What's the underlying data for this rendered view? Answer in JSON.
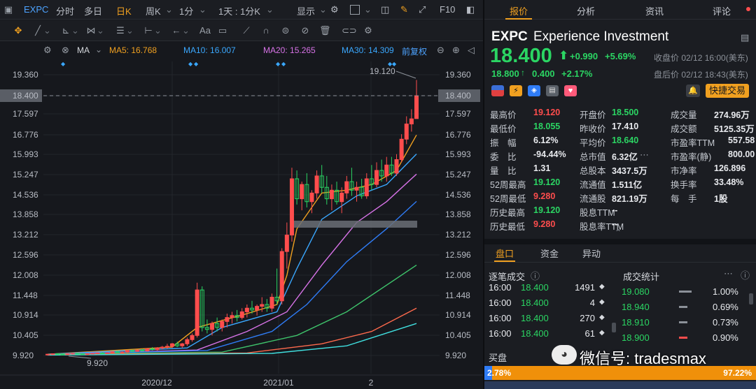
{
  "toolbar": {
    "symbol": "EXPC",
    "fenshi": "分时",
    "duori": "多日",
    "rik": "日K",
    "zhouk": "周K",
    "yifen": "1分",
    "range": "1天 : 1分K",
    "display": "显示",
    "f10": "F10"
  },
  "toolbar2": {
    "aa": "Aa"
  },
  "indicator_bar": {
    "ma": "MA",
    "ma5": "MA5: 16.768",
    "ma10": "MA10: 16.007",
    "ma20": "MA20: 15.265",
    "ma30": "MA30: 14.309",
    "fuquan": "前复权"
  },
  "colors": {
    "up": "#ff4d4d",
    "down": "#2bd563",
    "ma5": "#f0a020",
    "ma10": "#3aa8ff",
    "ma20": "#d873e8",
    "ma30": "#2f7cf6",
    "ma60": "#3ec36b",
    "ma120": "#ff6a4d",
    "ma250": "#40e0e0",
    "accent": "#f0a020"
  },
  "chart_data": {
    "type": "candlestick",
    "y_ticks": [
      "19.360",
      "18.400",
      "17.597",
      "16.776",
      "15.993",
      "15.247",
      "14.536",
      "13.858",
      "13.212",
      "12.596",
      "12.008",
      "11.448",
      "10.914",
      "10.405",
      "9.920"
    ],
    "x_ticks": [
      "2020/12",
      "2021/01",
      "2"
    ],
    "annotations": {
      "high": "19.120",
      "low": "9.920",
      "last": "18.400"
    },
    "candles": [
      [
        9.95,
        9.96,
        9.92,
        9.95
      ],
      [
        9.95,
        9.97,
        9.93,
        9.96
      ],
      [
        9.96,
        9.97,
        9.94,
        9.95
      ],
      [
        9.95,
        9.96,
        9.93,
        9.94
      ],
      [
        9.94,
        9.97,
        9.93,
        9.96
      ],
      [
        9.96,
        9.98,
        9.94,
        9.97
      ],
      [
        9.97,
        9.98,
        9.95,
        9.96
      ],
      [
        9.96,
        9.97,
        9.94,
        9.95
      ],
      [
        9.95,
        9.97,
        9.93,
        9.96
      ],
      [
        9.96,
        9.98,
        9.95,
        9.97
      ],
      [
        9.97,
        9.99,
        9.95,
        9.98
      ],
      [
        9.98,
        10.0,
        9.96,
        9.97
      ],
      [
        9.97,
        9.99,
        9.96,
        9.98
      ],
      [
        9.98,
        10.02,
        9.97,
        10.01
      ],
      [
        10.01,
        10.03,
        9.98,
        9.99
      ],
      [
        9.99,
        10.02,
        9.97,
        10.0
      ],
      [
        10.0,
        10.05,
        9.98,
        10.04
      ],
      [
        10.04,
        10.06,
        10.0,
        10.02
      ],
      [
        10.02,
        10.06,
        10.0,
        10.05
      ],
      [
        10.05,
        10.08,
        10.02,
        10.03
      ],
      [
        10.03,
        10.1,
        10.01,
        10.08
      ],
      [
        10.08,
        10.12,
        10.04,
        10.06
      ],
      [
        10.06,
        10.12,
        10.04,
        10.1
      ],
      [
        10.1,
        10.15,
        10.06,
        10.12
      ],
      [
        10.12,
        10.2,
        10.08,
        10.14
      ],
      [
        10.14,
        10.22,
        10.1,
        10.2
      ],
      [
        10.2,
        10.25,
        10.12,
        10.15
      ],
      [
        10.15,
        10.22,
        10.1,
        10.2
      ],
      [
        10.2,
        10.35,
        10.15,
        10.3
      ],
      [
        10.3,
        10.45,
        10.25,
        10.4
      ],
      [
        10.4,
        11.8,
        10.35,
        11.6
      ],
      [
        11.6,
        11.7,
        10.5,
        10.6
      ],
      [
        10.6,
        10.8,
        10.45,
        10.55
      ],
      [
        10.55,
        10.75,
        10.4,
        10.7
      ],
      [
        10.7,
        10.85,
        10.5,
        10.6
      ],
      [
        10.6,
        10.8,
        10.5,
        10.75
      ],
      [
        10.75,
        10.95,
        10.6,
        10.85
      ],
      [
        10.85,
        11.0,
        10.7,
        10.9
      ],
      [
        10.9,
        11.05,
        10.75,
        10.85
      ],
      [
        10.85,
        11.1,
        10.8,
        11.0
      ],
      [
        11.0,
        11.2,
        10.85,
        11.1
      ],
      [
        11.1,
        11.3,
        10.95,
        11.05
      ],
      [
        11.05,
        11.2,
        10.9,
        11.15
      ],
      [
        11.15,
        11.4,
        11.0,
        11.2
      ],
      [
        11.2,
        11.35,
        11.0,
        11.1
      ],
      [
        11.1,
        11.5,
        11.0,
        11.4
      ],
      [
        11.4,
        12.2,
        11.2,
        11.3
      ],
      [
        11.3,
        12.8,
        11.2,
        12.7
      ],
      [
        12.7,
        13.6,
        12.2,
        13.2
      ],
      [
        13.2,
        15.5,
        13.0,
        15.1
      ],
      [
        15.1,
        15.4,
        14.2,
        14.4
      ],
      [
        14.4,
        15.0,
        14.0,
        14.9
      ],
      [
        14.9,
        15.3,
        14.1,
        14.3
      ],
      [
        14.3,
        14.7,
        13.9,
        14.6
      ],
      [
        14.6,
        15.4,
        14.4,
        15.2
      ],
      [
        15.2,
        15.6,
        14.6,
        14.8
      ],
      [
        14.8,
        15.2,
        14.2,
        14.4
      ],
      [
        14.4,
        14.9,
        14.0,
        14.7
      ],
      [
        14.7,
        15.0,
        14.2,
        14.3
      ],
      [
        14.3,
        14.8,
        13.9,
        14.6
      ],
      [
        14.6,
        15.2,
        14.4,
        15.0
      ],
      [
        15.0,
        15.5,
        14.5,
        14.7
      ],
      [
        14.7,
        15.0,
        14.3,
        14.8
      ],
      [
        14.8,
        15.1,
        14.4,
        14.5
      ],
      [
        14.5,
        15.3,
        14.4,
        15.1
      ],
      [
        15.1,
        15.6,
        14.7,
        14.9
      ],
      [
        14.9,
        15.7,
        14.8,
        15.4
      ],
      [
        15.4,
        15.8,
        15.0,
        15.2
      ],
      [
        15.2,
        15.9,
        15.0,
        15.6
      ],
      [
        15.6,
        15.9,
        15.2,
        15.3
      ],
      [
        15.3,
        16.0,
        15.2,
        15.8
      ],
      [
        15.8,
        16.8,
        15.7,
        16.6
      ],
      [
        16.6,
        17.5,
        16.4,
        17.2
      ],
      [
        17.2,
        17.8,
        16.9,
        17.4
      ],
      [
        17.41,
        19.12,
        18.055,
        18.4
      ]
    ],
    "ma": [
      {
        "name": "MA5",
        "color": "#f0a020",
        "values": [
          [
            0,
            9.95
          ],
          [
            25,
            10.12
          ],
          [
            30,
            10.6
          ],
          [
            40,
            10.95
          ],
          [
            46,
            11.2
          ],
          [
            48,
            12.0
          ],
          [
            50,
            13.4
          ],
          [
            55,
            14.6
          ],
          [
            60,
            14.7
          ],
          [
            65,
            14.9
          ],
          [
            70,
            15.4
          ],
          [
            74,
            16.768
          ]
        ]
      },
      {
        "name": "MA10",
        "color": "#3aa8ff",
        "values": [
          [
            0,
            9.95
          ],
          [
            28,
            10.1
          ],
          [
            35,
            10.6
          ],
          [
            46,
            11.0
          ],
          [
            50,
            12.2
          ],
          [
            55,
            13.7
          ],
          [
            62,
            14.5
          ],
          [
            68,
            14.9
          ],
          [
            74,
            16.007
          ]
        ]
      },
      {
        "name": "MA20",
        "color": "#d873e8",
        "values": [
          [
            0,
            9.95
          ],
          [
            30,
            10.05
          ],
          [
            40,
            10.5
          ],
          [
            48,
            11.0
          ],
          [
            55,
            12.3
          ],
          [
            62,
            13.6
          ],
          [
            68,
            14.3
          ],
          [
            74,
            15.265
          ]
        ]
      },
      {
        "name": "MA30",
        "color": "#2f7cf6",
        "values": [
          [
            0,
            9.95
          ],
          [
            32,
            10.04
          ],
          [
            45,
            10.5
          ],
          [
            52,
            11.2
          ],
          [
            60,
            12.4
          ],
          [
            68,
            13.4
          ],
          [
            74,
            14.309
          ]
        ]
      },
      {
        "name": "MA60",
        "color": "#3ec36b",
        "values": [
          [
            0,
            9.95
          ],
          [
            35,
            10.0
          ],
          [
            50,
            10.4
          ],
          [
            60,
            11.0
          ],
          [
            74,
            12.3
          ]
        ]
      },
      {
        "name": "MA120",
        "color": "#ff6a4d",
        "values": [
          [
            0,
            9.94
          ],
          [
            40,
            9.98
          ],
          [
            55,
            10.2
          ],
          [
            65,
            10.5
          ],
          [
            74,
            11.1
          ]
        ]
      },
      {
        "name": "MA250",
        "color": "#40e0e0",
        "values": [
          [
            0,
            9.93
          ],
          [
            45,
            9.97
          ],
          [
            60,
            10.15
          ],
          [
            74,
            10.7
          ]
        ]
      }
    ]
  },
  "right": {
    "tabs": [
      "报价",
      "分析",
      "资讯",
      "评论"
    ],
    "symbol": "EXPC",
    "name": "Experience Investment",
    "price": "18.400",
    "change": "+0.990",
    "change_pct": "+5.69%",
    "close_time": "收盘价 02/12 16:00(美东)",
    "after_price": "18.800",
    "after_change": "0.400",
    "after_pct": "+2.17%",
    "after_time": "盘后价 02/12 18:43(美东)",
    "quick_trade": "快捷交易",
    "stats": [
      [
        "最高价",
        "19.120",
        "red",
        "开盘价",
        "18.500",
        "green",
        "成交量",
        "274.96万",
        "white"
      ],
      [
        "最低价",
        "18.055",
        "green",
        "昨收价",
        "17.410",
        "white",
        "成交额",
        "5125.35万",
        "white"
      ],
      [
        "振　幅",
        "6.12%",
        "white",
        "平均价",
        "18.640",
        "green",
        "市盈率TTM",
        "557.58",
        "white"
      ],
      [
        "委　比",
        "-94.44%",
        "white",
        "总市值",
        "6.32亿",
        "white",
        "市盈率(静)",
        "800.00",
        "white"
      ],
      [
        "量　比",
        "1.31",
        "white",
        "总股本",
        "3437.5万",
        "white",
        "市净率",
        "126.896",
        "white"
      ],
      [
        "52周最高",
        "19.120",
        "green",
        "流通值",
        "1.511亿",
        "white",
        "换手率",
        "33.48%",
        "white"
      ],
      [
        "52周最低",
        "9.280",
        "red",
        "流通股",
        "821.19万",
        "white",
        "每　手",
        "1股",
        "white"
      ],
      [
        "历史最高",
        "19.120",
        "green",
        "股息TTM",
        "--",
        "white",
        "",
        "",
        ""
      ],
      [
        "历史最低",
        "9.280",
        "red",
        "股息率TTM",
        "--",
        "white",
        "",
        "",
        ""
      ]
    ],
    "subtabs": [
      "盘口",
      "资金",
      "异动"
    ],
    "ticks_title": "逐笔成交",
    "stats_title": "成交统计",
    "ticks": [
      [
        "16:00",
        "18.400",
        "1491"
      ],
      [
        "16:00",
        "18.400",
        "4"
      ],
      [
        "16:00",
        "18.400",
        "270"
      ],
      [
        "16:00",
        "18.400",
        "61"
      ]
    ],
    "tick_stats": [
      [
        "19.080",
        "1.00%"
      ],
      [
        "18.940",
        "0.69%"
      ],
      [
        "18.910",
        "0.73%"
      ],
      [
        "18.900",
        "0.90%"
      ]
    ],
    "buy_label": "买盘",
    "buy_pct": "2.78%",
    "sell_pct": "97.22%",
    "watermark": "微信号: tradesmax"
  }
}
